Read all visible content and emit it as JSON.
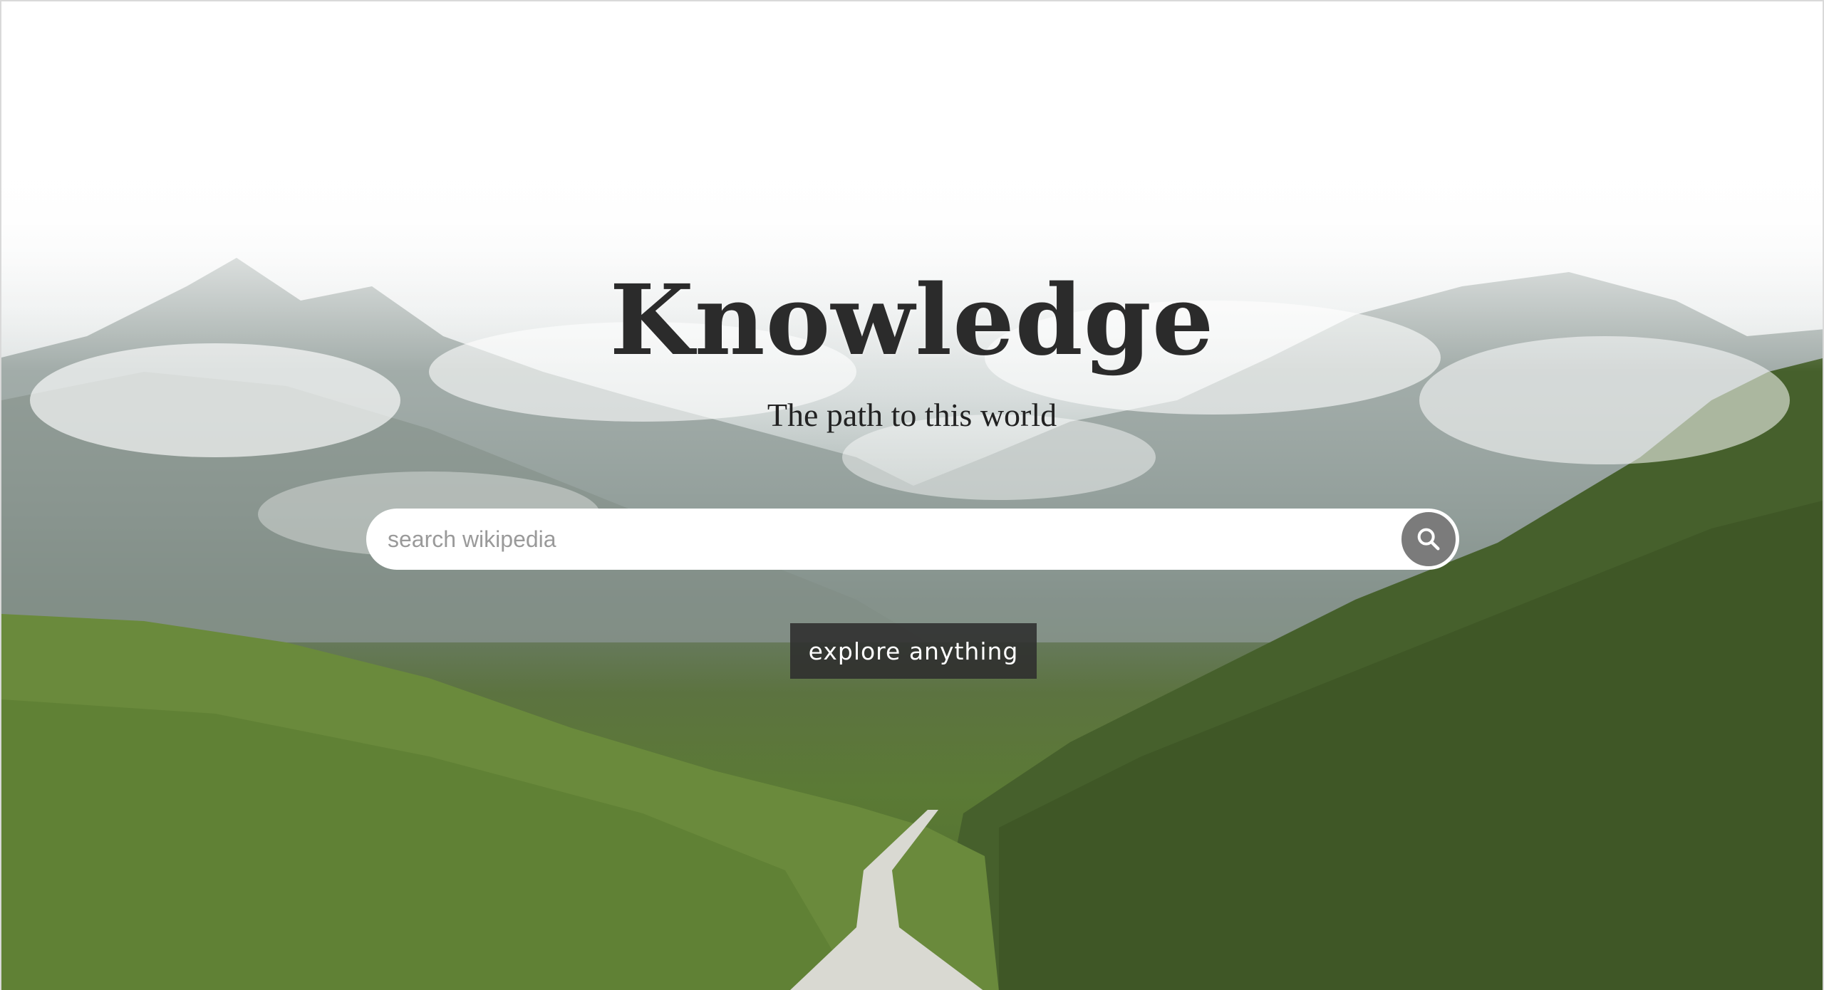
{
  "hero": {
    "title": "Knowledge",
    "subtitle": "The path to this world"
  },
  "search": {
    "placeholder": "search wikipedia",
    "value": "",
    "button_icon": "search-icon"
  },
  "explore": {
    "label": "explore anything"
  },
  "colors": {
    "title": "#2b2b2b",
    "search_button": "#7b7b7b",
    "explore_button": "#2d2d2d"
  }
}
